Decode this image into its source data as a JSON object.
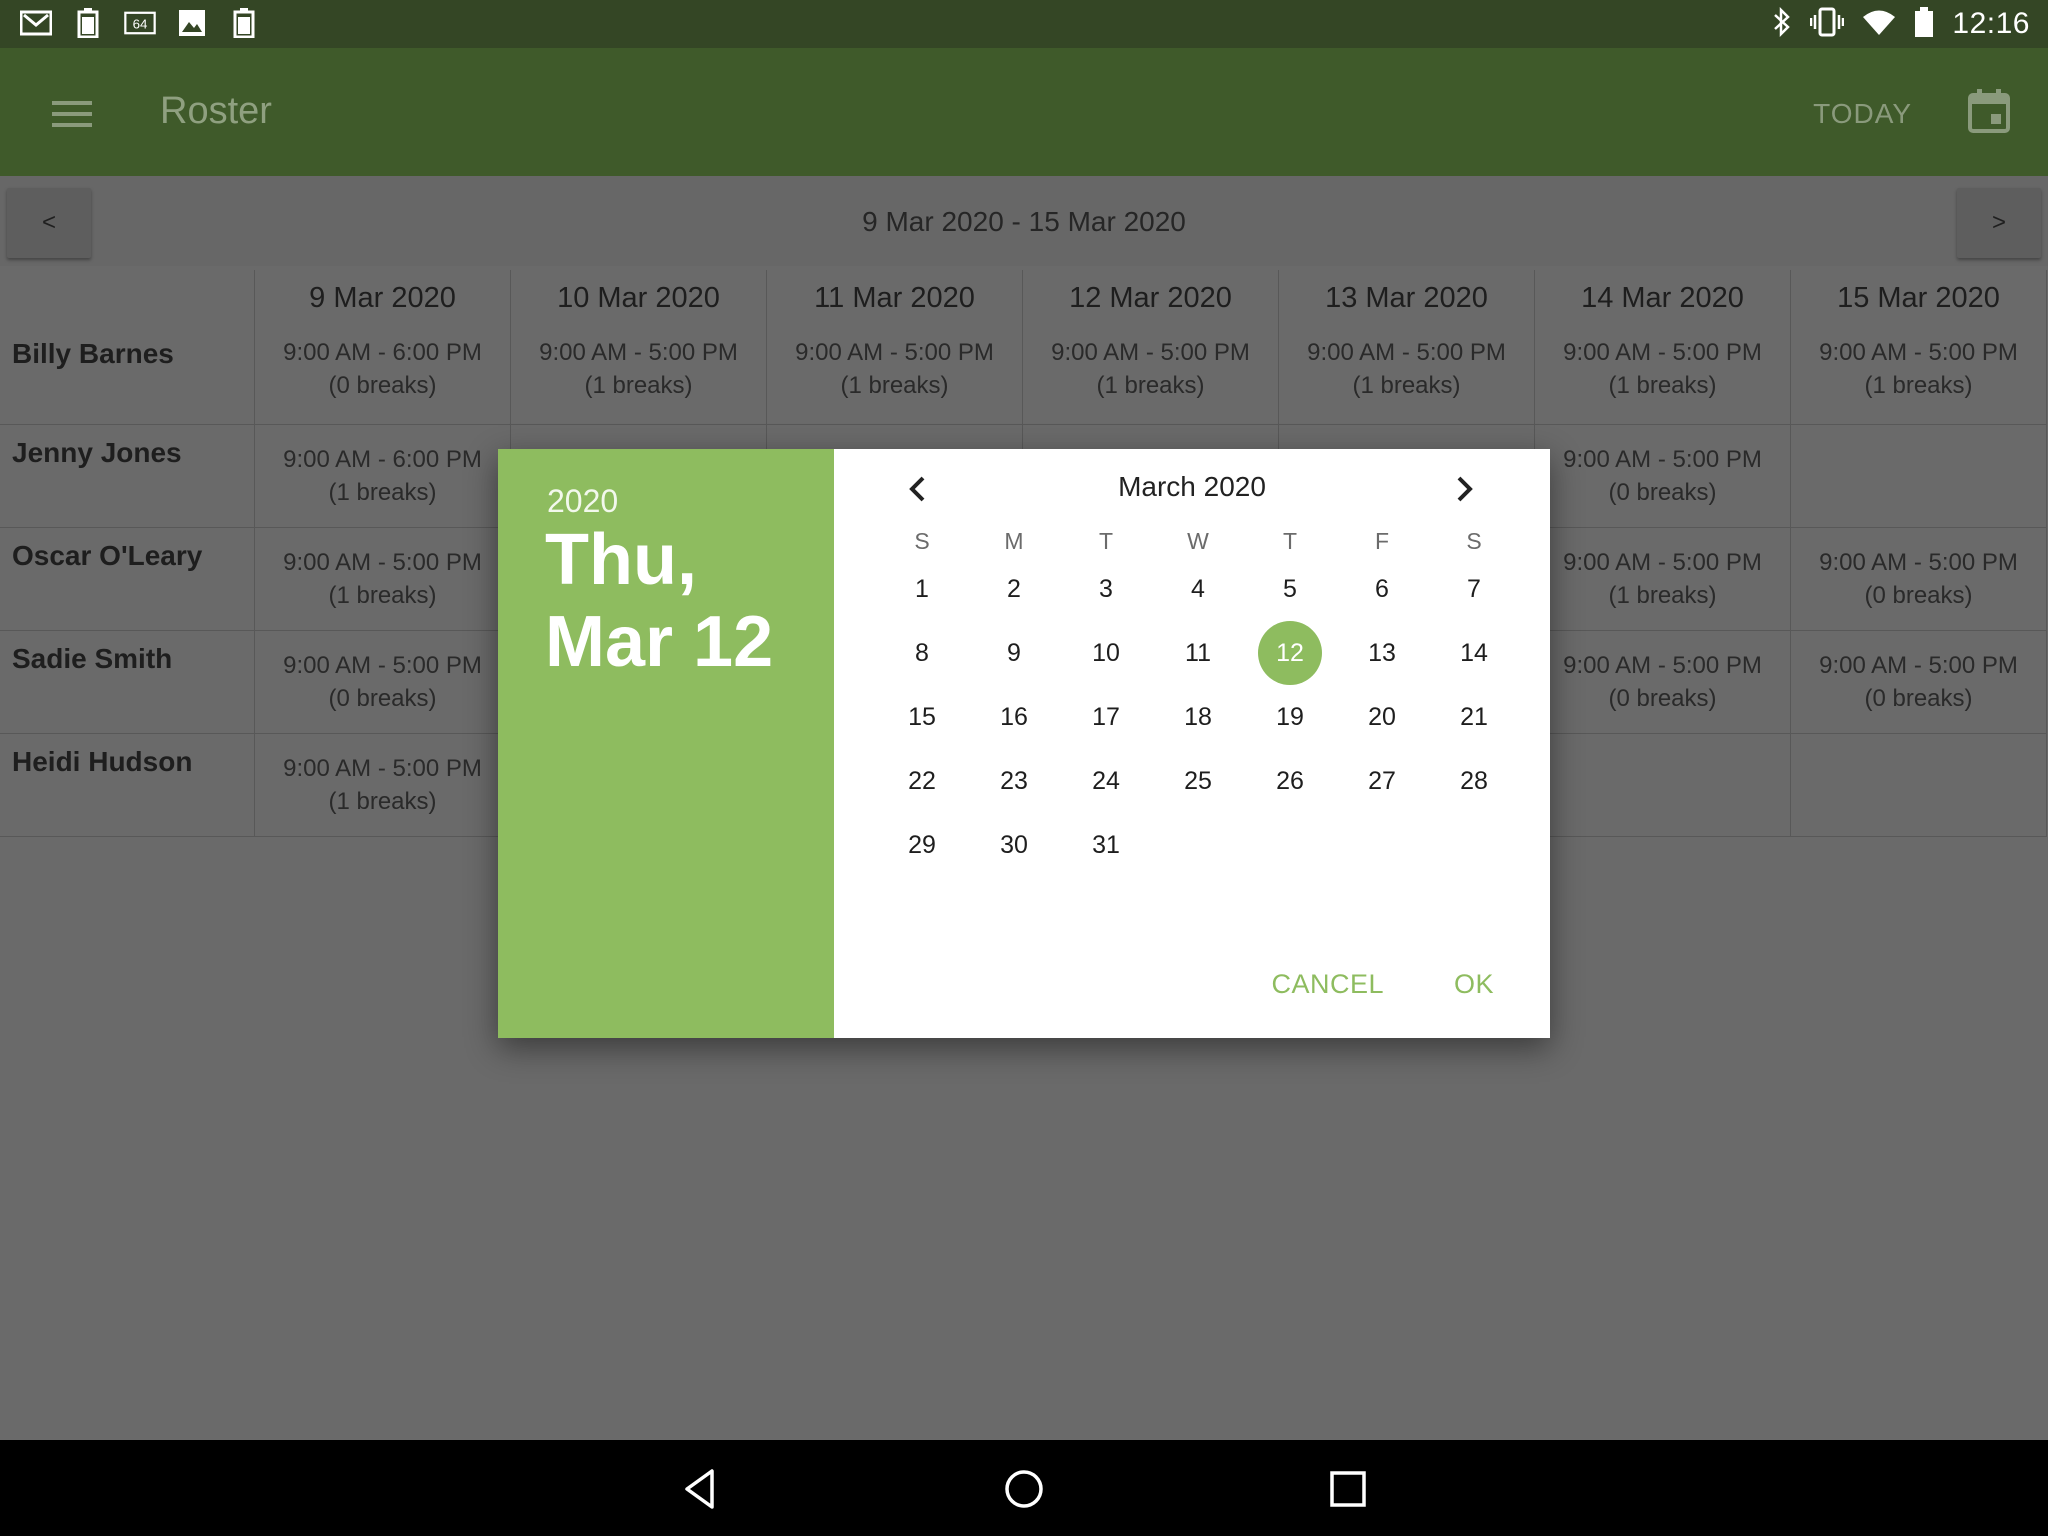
{
  "status_bar": {
    "left_icons": [
      "gmail-icon",
      "battery-saver-icon",
      "64-badge-icon",
      "image-icon",
      "battery-saver-icon"
    ],
    "right_icons": [
      "bluetooth-icon",
      "vibrate-icon",
      "wifi-icon",
      "battery-icon"
    ],
    "time": "12:16"
  },
  "app_bar": {
    "title": "Roster",
    "today_label": "TODAY",
    "menu_icon": "menu-icon",
    "calendar_icon": "calendar-icon"
  },
  "week_nav": {
    "prev_label": "<",
    "next_label": ">",
    "range": "9 Mar 2020 - 15 Mar 2020"
  },
  "roster": {
    "dates": [
      "9 Mar 2020",
      "10 Mar 2020",
      "11 Mar 2020",
      "12 Mar 2020",
      "13 Mar 2020",
      "14 Mar 2020",
      "15 Mar 2020"
    ],
    "rows": [
      {
        "name": "Billy Barnes",
        "shifts": [
          {
            "time": "9:00 AM - 6:00 PM",
            "breaks": "(0 breaks)"
          },
          {
            "time": "9:00 AM - 5:00 PM",
            "breaks": "(1 breaks)"
          },
          {
            "time": "9:00 AM - 5:00 PM",
            "breaks": "(1 breaks)"
          },
          {
            "time": "9:00 AM - 5:00 PM",
            "breaks": "(1 breaks)"
          },
          {
            "time": "9:00 AM - 5:00 PM",
            "breaks": "(1 breaks)"
          },
          {
            "time": "9:00 AM - 5:00 PM",
            "breaks": "(1 breaks)"
          },
          {
            "time": "9:00 AM - 5:00 PM",
            "breaks": "(1 breaks)"
          }
        ]
      },
      {
        "name": "Jenny Jones",
        "shifts": [
          {
            "time": "9:00 AM - 6:00 PM",
            "breaks": "(1 breaks)"
          },
          null,
          null,
          null,
          null,
          {
            "time": "9:00 AM - 5:00 PM",
            "breaks": "(0 breaks)"
          },
          null
        ]
      },
      {
        "name": "Oscar O'Leary",
        "shifts": [
          {
            "time": "9:00 AM - 5:00 PM",
            "breaks": "(1 breaks)"
          },
          null,
          null,
          null,
          null,
          {
            "time": "9:00 AM - 5:00 PM",
            "breaks": "(1 breaks)"
          },
          {
            "time": "9:00 AM - 5:00 PM",
            "breaks": "(0 breaks)"
          }
        ]
      },
      {
        "name": "Sadie Smith",
        "shifts": [
          {
            "time": "9:00 AM - 5:00 PM",
            "breaks": "(0 breaks)"
          },
          null,
          null,
          null,
          null,
          {
            "time": "9:00 AM - 5:00 PM",
            "breaks": "(0 breaks)"
          },
          {
            "time": "9:00 AM - 5:00 PM",
            "breaks": "(0 breaks)"
          }
        ]
      },
      {
        "name": "Heidi Hudson",
        "shifts": [
          {
            "time": "9:00 AM - 5:00 PM",
            "breaks": "(1 breaks)"
          },
          null,
          null,
          null,
          null,
          null,
          null
        ]
      }
    ]
  },
  "date_picker": {
    "year": "2020",
    "selected_line1": "Thu,",
    "selected_line2": "Mar 12",
    "month_title": "March 2020",
    "weekdays": [
      "S",
      "M",
      "T",
      "W",
      "T",
      "F",
      "S"
    ],
    "leading_blanks": 0,
    "days": [
      "1",
      "2",
      "3",
      "4",
      "5",
      "6",
      "7",
      "8",
      "9",
      "10",
      "11",
      "12",
      "13",
      "14",
      "15",
      "16",
      "17",
      "18",
      "19",
      "20",
      "21",
      "22",
      "23",
      "24",
      "25",
      "26",
      "27",
      "28",
      "29",
      "30",
      "31"
    ],
    "selected_day": "12",
    "cancel_label": "CANCEL",
    "ok_label": "OK",
    "accent_color": "#8ebc5f"
  },
  "nav_bar": {
    "icons": [
      "back-icon",
      "home-icon",
      "recents-icon"
    ]
  }
}
